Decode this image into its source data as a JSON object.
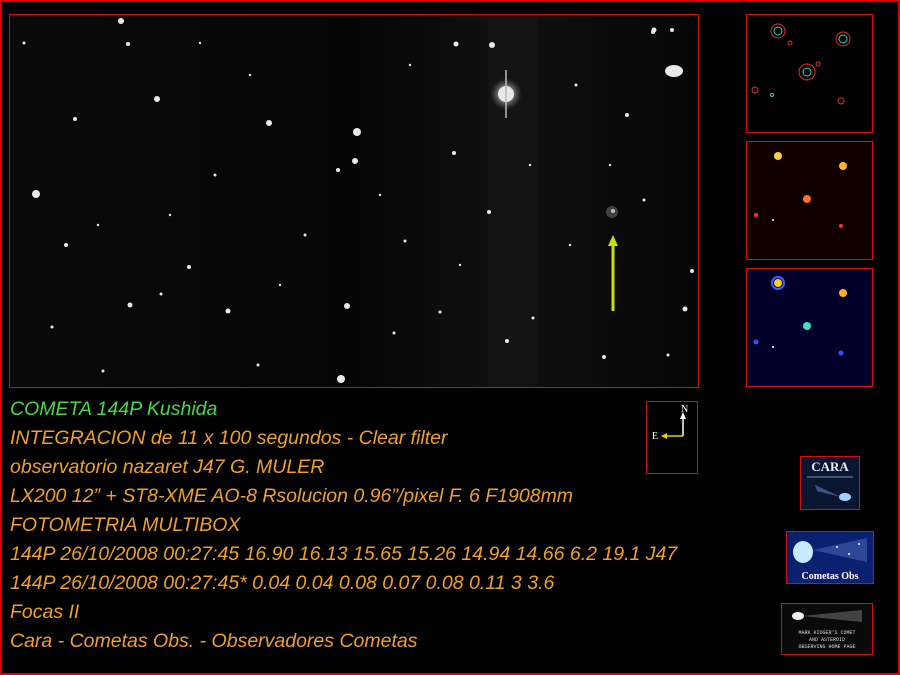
{
  "caption": {
    "title": "COMETA  144P Kushida",
    "lines": [
      "INTEGRACION de 11 x 100 segundos - Clear filter",
      "observatorio nazaret J47  G. MULER",
      "LX200 12” +  ST8-XME AO-8  Rsolucion 0.96”/pixel   F. 6      F1908mm",
      "FOTOMETRIA MULTIBOX",
      "144P 26/10/2008 00:27:45 16.90 16.13 15.65 15.26 14.94 14.66 6.2 19.1 J47",
      "144P 26/10/2008 00:27:45* 0.04 0.04 0.08 0.07 0.08 0.11 3 3.6",
      "Focas II",
      "Cara - Cometas Obs. - Observadores Cometas"
    ]
  },
  "compass": {
    "north": "N",
    "east": "E"
  },
  "logos": {
    "cara": "CARA",
    "cometas": "Cometas  Obs",
    "kidger_lines": [
      "MARK KIDGER'S COMET",
      "AND ASTEROID",
      "OBSERVING HOME PAGE"
    ]
  },
  "colors": {
    "frame": "#e00000",
    "caption_title": "#48d848",
    "caption_text": "#f0a028",
    "marker_arrow": "#c8e000"
  }
}
